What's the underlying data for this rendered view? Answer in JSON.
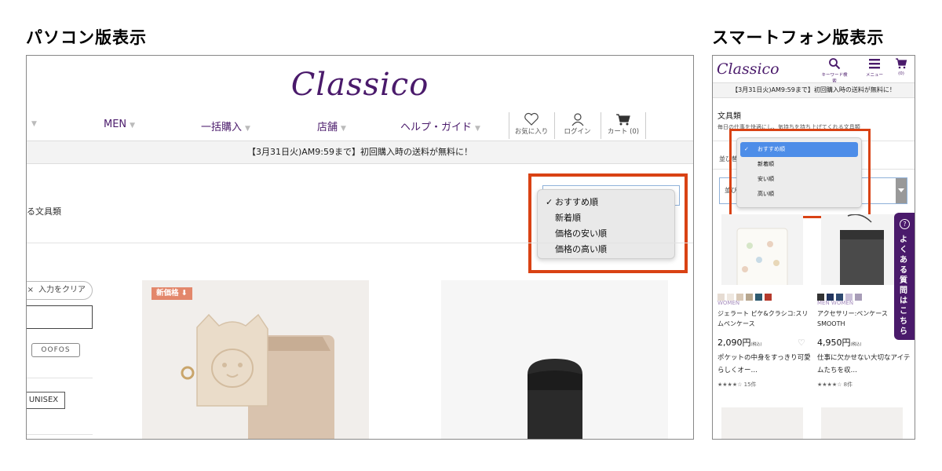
{
  "titles": {
    "pc": "パソコン版表示",
    "sp": "スマートフォン版表示"
  },
  "pc": {
    "logo": "Classico",
    "nav": [
      "MEN",
      "一括購入",
      "店舗",
      "ヘルプ・ガイド"
    ],
    "util": {
      "favorites": "お気に入り",
      "login": "ログイン",
      "cart": "カート (0)"
    },
    "banner": "【3月31日火)AM9:59まで】初回購入時の送料が無料に！",
    "subtitle": "る文具類",
    "sort_options": [
      "おすすめ順",
      "新着順",
      "価格の安い順",
      "価格の高い順"
    ],
    "sort_selected": "おすすめ順",
    "filter": {
      "clear": "入力をクリア",
      "tag_brand": "OOFOS",
      "tag_gender": "UNISEX"
    },
    "products": [
      {
        "badge": "新価格"
      }
    ]
  },
  "sp": {
    "logo": "Classico",
    "icons": {
      "search": "キーワード検索",
      "menu": "メニュー",
      "cart": "(0)"
    },
    "banner": "【3月31日火)AM9:59まで】初回購入時の送料が無料に！",
    "category": "文具類",
    "desc": "毎日の仕事を快適にし、気持ちを持ち上げてくれる文具類",
    "sort_label": "並び替え",
    "sort_select_label": "並び",
    "sort_options": [
      "おすすめ順",
      "新着順",
      "安い順",
      "高い順"
    ],
    "help_tab": "よくある質問はこちら",
    "products": [
      {
        "brand": "WOMEN",
        "name": "ジェラート ピケ&クラシコ:スリムペンケース",
        "price": "2,090円",
        "tax": "(税込)",
        "copy": "ポケットの中身をすっきり可愛らしくオー…",
        "reviews": "15件",
        "swatches": [
          "#e6dcd3",
          "#efe8e1",
          "#d9c9b7",
          "#b7a68e",
          "#2e5a70",
          "#b53a2c"
        ]
      },
      {
        "brand": "MEN WOMEN",
        "name": "アクセサリー:ペンケース SMOOTH",
        "price": "4,950円",
        "tax": "(税込)",
        "copy": "仕事に欠かせない大切なアイテムたちを収…",
        "reviews": "8件",
        "swatches": [
          "#333333",
          "#23355e",
          "#2e4a70",
          "#c8bfd8",
          "#a89db8"
        ]
      }
    ]
  }
}
